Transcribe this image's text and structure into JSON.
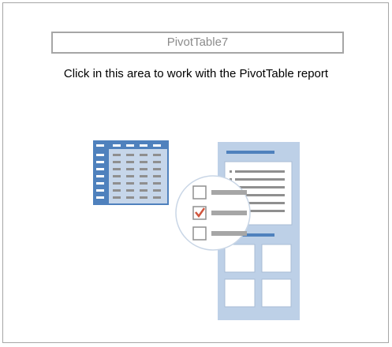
{
  "pivot": {
    "name": "PivotTable7",
    "instruction": "Click in this area to work with the PivotTable report"
  },
  "illustration": {
    "icons": [
      "table-grid-icon",
      "field-list-pane-icon",
      "checkbox-list-magnifier-icon"
    ],
    "colors": {
      "table_blue": "#4f81bd",
      "pane_blue": "#bdd0e7",
      "dash_gray": "#9b9b9b",
      "check_red": "#d0553d",
      "border_gray": "#a6a6a6"
    }
  }
}
